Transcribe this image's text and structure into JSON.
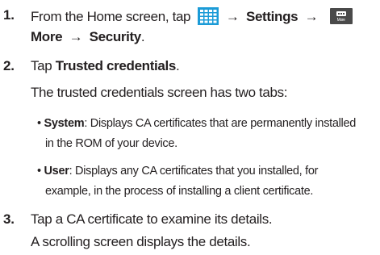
{
  "steps": [
    {
      "number": "1.",
      "line1_prefix": "From the Home screen, tap",
      "arrow1": "→",
      "settings": "Settings",
      "arrow2": "→",
      "more_icon_label": "More",
      "more_bold": "More",
      "arrow3": "→",
      "security": "Security",
      "period": "."
    },
    {
      "number": "2.",
      "tap": "Tap",
      "trusted_credentials": "Trusted credentials",
      "period": ".",
      "intro": "The trusted credentials screen has two tabs:",
      "bullets": [
        {
          "marker": "•",
          "term": "System",
          "line1_rest": ": Displays CA certificates that are permanently installed",
          "line2": "in the ROM of your device."
        },
        {
          "marker": "•",
          "term": "User",
          "line1_rest": ": Displays any CA certificates that you installed, for",
          "line2": "example, in the process of installing a client certificate."
        }
      ]
    },
    {
      "number": "3.",
      "line1": "Tap a CA certificate to examine its details.",
      "line2": "A scrolling screen displays the details."
    }
  ],
  "icons": {
    "apps": "apps-grid-icon",
    "more": "more-icon"
  },
  "colors": {
    "text": "#231f20",
    "apps_icon": "#1b9bd7",
    "more_icon": "#4a4a4a"
  }
}
